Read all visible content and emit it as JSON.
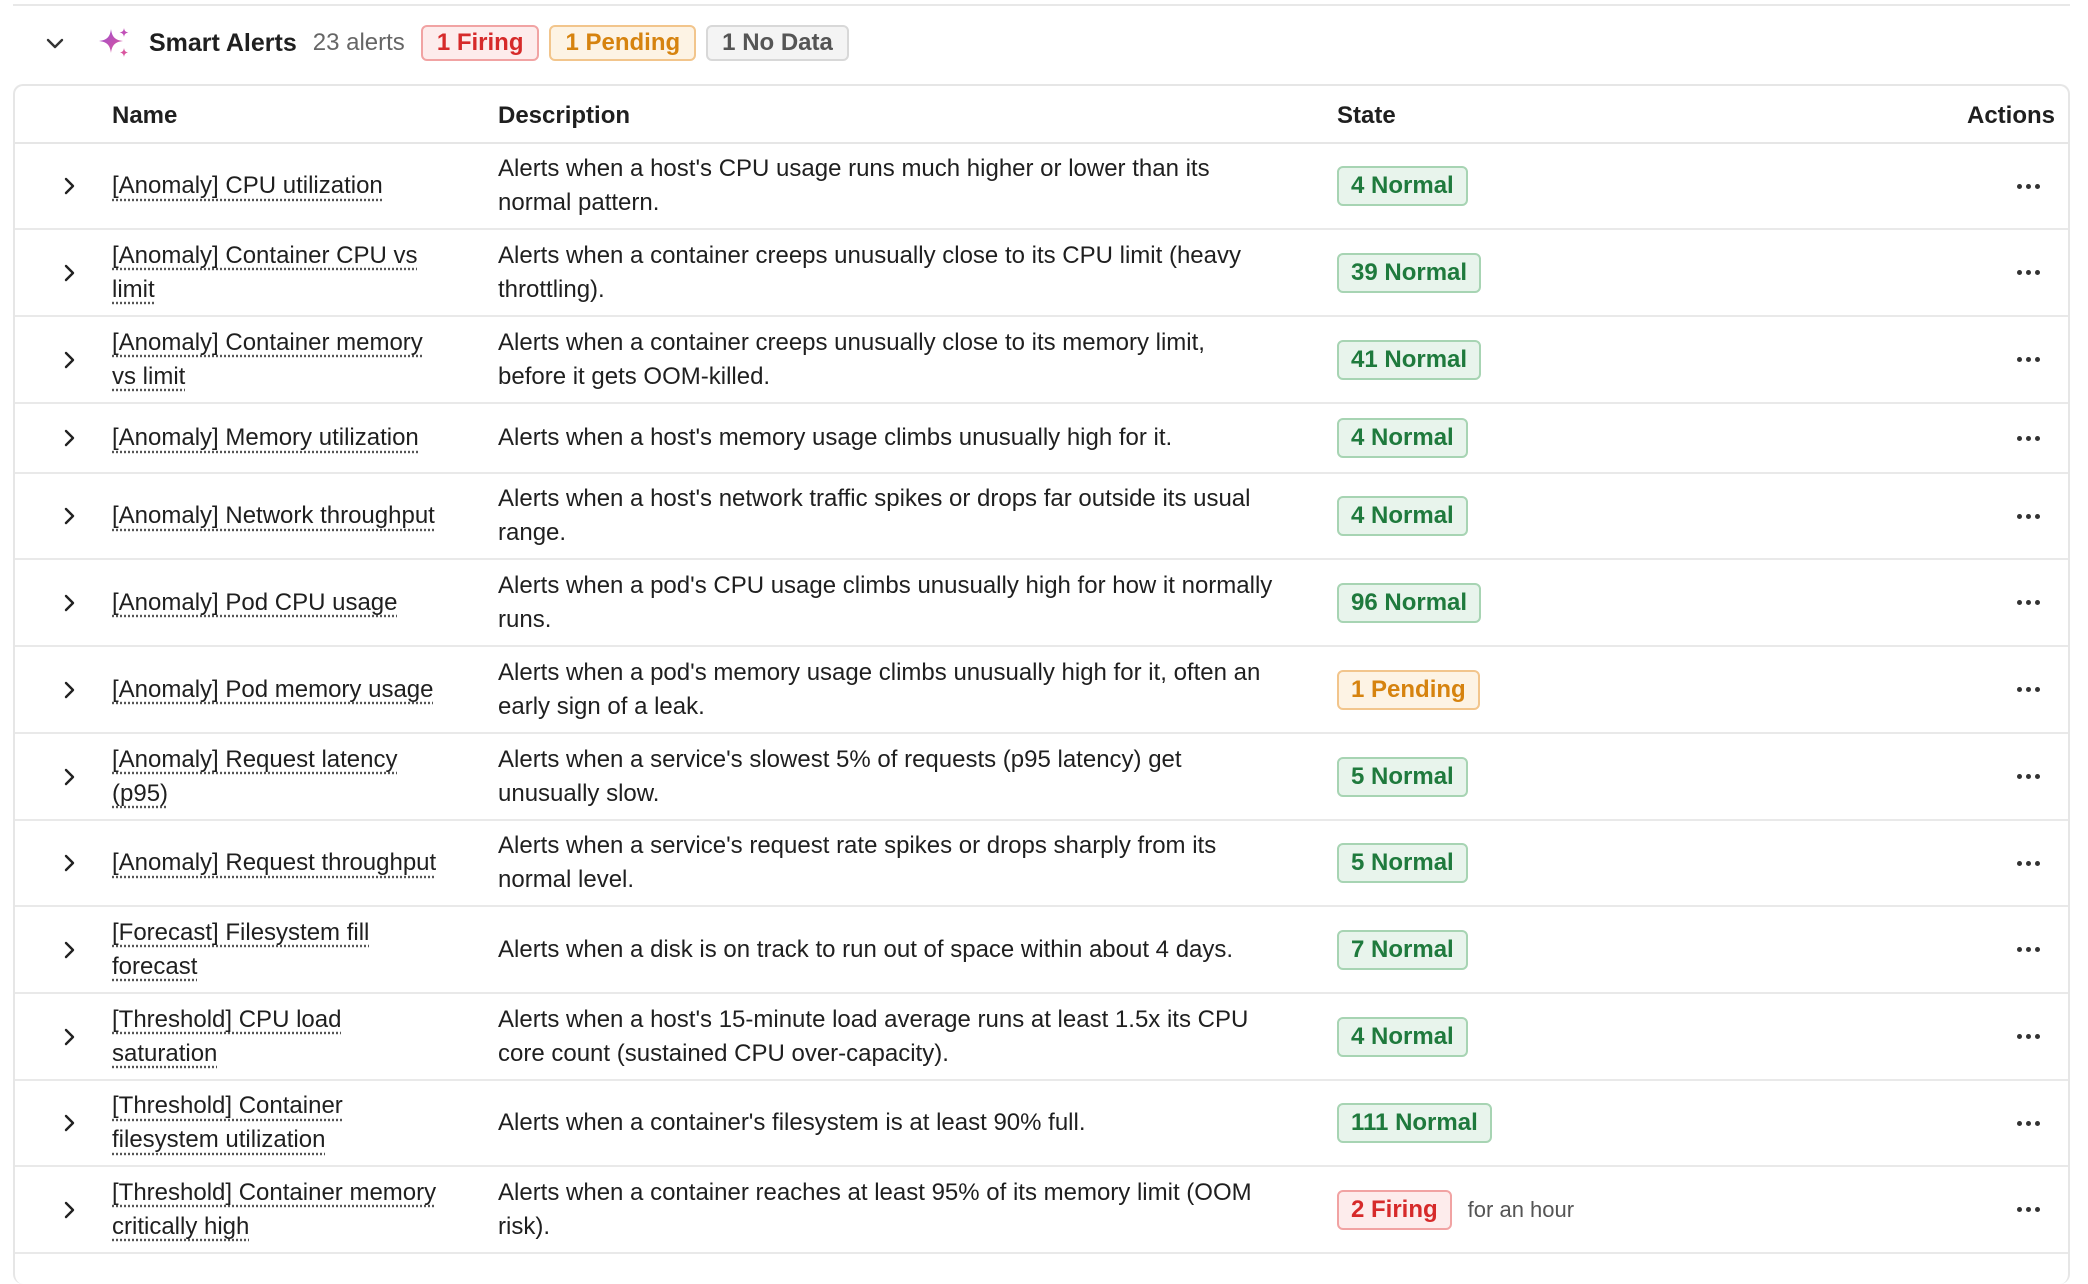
{
  "header": {
    "title": "Smart Alerts",
    "count": "23 alerts",
    "chips": {
      "firing": "1 Firing",
      "pending": "1 Pending",
      "nodata": "1 No Data"
    }
  },
  "table": {
    "columns": {
      "name": "Name",
      "description": "Description",
      "state": "State",
      "actions": "Actions"
    },
    "rows": [
      {
        "name_lines": [
          "[Anomaly] CPU utilization"
        ],
        "desc_lines": [
          "Alerts when a host's CPU usage runs much higher or lower than its",
          "normal pattern."
        ],
        "state": "4 Normal",
        "state_kind": "normal",
        "since": ""
      },
      {
        "name_lines": [
          "[Anomaly] Container CPU vs",
          "limit"
        ],
        "desc_lines": [
          "Alerts when a container creeps unusually close to its CPU limit (heavy",
          "throttling)."
        ],
        "state": "39 Normal",
        "state_kind": "normal",
        "since": ""
      },
      {
        "name_lines": [
          "[Anomaly] Container memory",
          "vs limit"
        ],
        "desc_lines": [
          "Alerts when a container creeps unusually close to its memory limit,",
          "before it gets OOM-killed."
        ],
        "state": "41 Normal",
        "state_kind": "normal",
        "since": ""
      },
      {
        "name_lines": [
          "[Anomaly] Memory utilization"
        ],
        "desc_lines": [
          "Alerts when a host's memory usage climbs unusually high for it."
        ],
        "state": "4 Normal",
        "state_kind": "normal",
        "since": ""
      },
      {
        "name_lines": [
          "[Anomaly] Network throughput"
        ],
        "desc_lines": [
          "Alerts when a host's network traffic spikes or drops far outside its usual",
          "range."
        ],
        "state": "4 Normal",
        "state_kind": "normal",
        "since": ""
      },
      {
        "name_lines": [
          "[Anomaly] Pod CPU usage"
        ],
        "desc_lines": [
          "Alerts when a pod's CPU usage climbs unusually high for how it normally",
          "runs."
        ],
        "state": "96 Normal",
        "state_kind": "normal",
        "since": ""
      },
      {
        "name_lines": [
          "[Anomaly] Pod memory usage"
        ],
        "desc_lines": [
          "Alerts when a pod's memory usage climbs unusually high for it, often an",
          "early sign of a leak."
        ],
        "state": "1 Pending",
        "state_kind": "pending",
        "since": ""
      },
      {
        "name_lines": [
          "[Anomaly] Request latency",
          "(p95)"
        ],
        "desc_lines": [
          "Alerts when a service's slowest 5% of requests (p95 latency) get",
          "unusually slow."
        ],
        "state": "5 Normal",
        "state_kind": "normal",
        "since": ""
      },
      {
        "name_lines": [
          "[Anomaly] Request throughput"
        ],
        "desc_lines": [
          "Alerts when a service's request rate spikes or drops sharply from its",
          "normal level."
        ],
        "state": "5 Normal",
        "state_kind": "normal",
        "since": ""
      },
      {
        "name_lines": [
          "[Forecast] Filesystem fill",
          "forecast"
        ],
        "desc_lines": [
          "Alerts when a disk is on track to run out of space within about 4 days."
        ],
        "state": "7 Normal",
        "state_kind": "normal",
        "since": ""
      },
      {
        "name_lines": [
          "[Threshold] CPU load",
          "saturation"
        ],
        "desc_lines": [
          "Alerts when a host's 15-minute load average runs at least 1.5x its CPU",
          "core count (sustained CPU over-capacity)."
        ],
        "state": "4 Normal",
        "state_kind": "normal",
        "since": ""
      },
      {
        "name_lines": [
          "[Threshold] Container",
          "filesystem utilization"
        ],
        "desc_lines": [
          "Alerts when a container's filesystem is at least 90% full."
        ],
        "state": "111 Normal",
        "state_kind": "normal",
        "since": ""
      },
      {
        "name_lines": [
          "[Threshold] Container memory",
          "critically high"
        ],
        "desc_lines": [
          "Alerts when a container reaches at least 95% of its memory limit (OOM",
          "risk)."
        ],
        "state": "2 Firing",
        "state_kind": "firing",
        "since": "for an hour"
      }
    ]
  },
  "colors": {
    "normal": "#1f7a3d",
    "pending": "#d6830f",
    "firing": "#d62a2a",
    "sparkle_primary": "#9b4fd1",
    "sparkle_secondary": "#e0569a"
  },
  "icons": {
    "collapse": "chevron-down-icon",
    "sparkle": "sparkle-icon",
    "expand": "chevron-right-icon",
    "actions": "more-horizontal-icon"
  }
}
